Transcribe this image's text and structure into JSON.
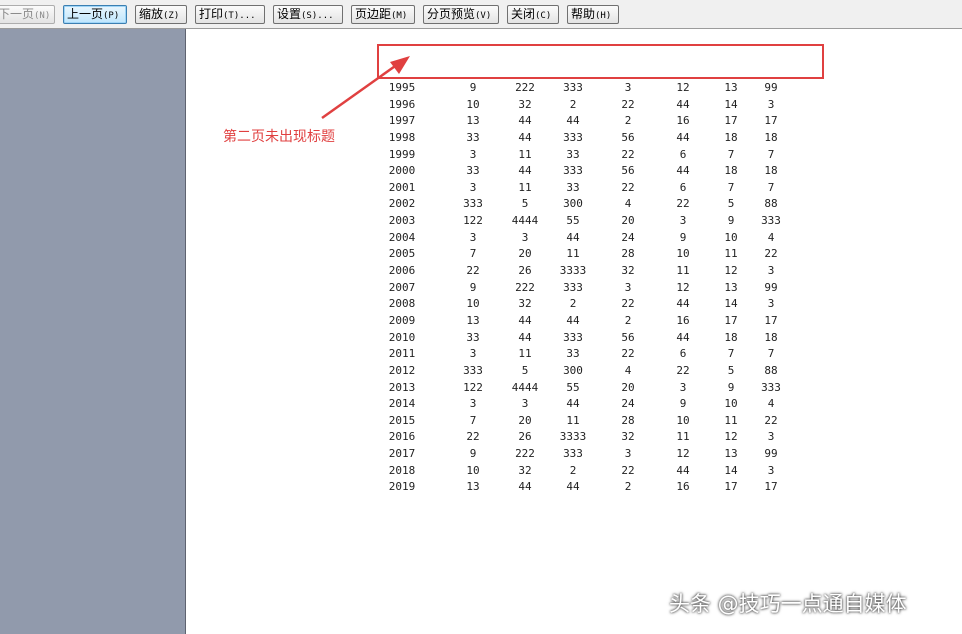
{
  "toolbar": {
    "buttons": [
      {
        "label": "下一页",
        "hotkey": "(N)"
      },
      {
        "label": "上一页",
        "hotkey": "(P)"
      },
      {
        "label": "缩放",
        "hotkey": "(Z)"
      },
      {
        "label": "打印",
        "hotkey": "(T)..."
      },
      {
        "label": "设置",
        "hotkey": "(S)..."
      },
      {
        "label": "页边距",
        "hotkey": "(M)"
      },
      {
        "label": "分页预览",
        "hotkey": "(V)"
      },
      {
        "label": "关闭",
        "hotkey": "(C)"
      },
      {
        "label": "帮助",
        "hotkey": "(H)"
      }
    ]
  },
  "annotation": {
    "note": "第二页未出现标题",
    "color": "#e04040"
  },
  "table": {
    "rows": [
      [
        "1995",
        "9",
        "222",
        "333",
        "3",
        "12",
        "13",
        "99"
      ],
      [
        "1996",
        "10",
        "32",
        "2",
        "22",
        "44",
        "14",
        "3"
      ],
      [
        "1997",
        "13",
        "44",
        "44",
        "2",
        "16",
        "17",
        "17"
      ],
      [
        "1998",
        "33",
        "44",
        "333",
        "56",
        "44",
        "18",
        "18"
      ],
      [
        "1999",
        "3",
        "11",
        "33",
        "22",
        "6",
        "7",
        "7"
      ],
      [
        "2000",
        "33",
        "44",
        "333",
        "56",
        "44",
        "18",
        "18"
      ],
      [
        "2001",
        "3",
        "11",
        "33",
        "22",
        "6",
        "7",
        "7"
      ],
      [
        "2002",
        "333",
        "5",
        "300",
        "4",
        "22",
        "5",
        "88"
      ],
      [
        "2003",
        "122",
        "4444",
        "55",
        "20",
        "3",
        "9",
        "333"
      ],
      [
        "2004",
        "3",
        "3",
        "44",
        "24",
        "9",
        "10",
        "4"
      ],
      [
        "2005",
        "7",
        "20",
        "11",
        "28",
        "10",
        "11",
        "22"
      ],
      [
        "2006",
        "22",
        "26",
        "3333",
        "32",
        "11",
        "12",
        "3"
      ],
      [
        "2007",
        "9",
        "222",
        "333",
        "3",
        "12",
        "13",
        "99"
      ],
      [
        "2008",
        "10",
        "32",
        "2",
        "22",
        "44",
        "14",
        "3"
      ],
      [
        "2009",
        "13",
        "44",
        "44",
        "2",
        "16",
        "17",
        "17"
      ],
      [
        "2010",
        "33",
        "44",
        "333",
        "56",
        "44",
        "18",
        "18"
      ],
      [
        "2011",
        "3",
        "11",
        "33",
        "22",
        "6",
        "7",
        "7"
      ],
      [
        "2012",
        "333",
        "5",
        "300",
        "4",
        "22",
        "5",
        "88"
      ],
      [
        "2013",
        "122",
        "4444",
        "55",
        "20",
        "3",
        "9",
        "333"
      ],
      [
        "2014",
        "3",
        "3",
        "44",
        "24",
        "9",
        "10",
        "4"
      ],
      [
        "2015",
        "7",
        "20",
        "11",
        "28",
        "10",
        "11",
        "22"
      ],
      [
        "2016",
        "22",
        "26",
        "3333",
        "32",
        "11",
        "12",
        "3"
      ],
      [
        "2017",
        "9",
        "222",
        "333",
        "3",
        "12",
        "13",
        "99"
      ],
      [
        "2018",
        "10",
        "32",
        "2",
        "22",
        "44",
        "14",
        "3"
      ],
      [
        "2019",
        "13",
        "44",
        "44",
        "2",
        "16",
        "17",
        "17"
      ]
    ]
  },
  "watermark": "头条 @技巧一点通自媒体"
}
